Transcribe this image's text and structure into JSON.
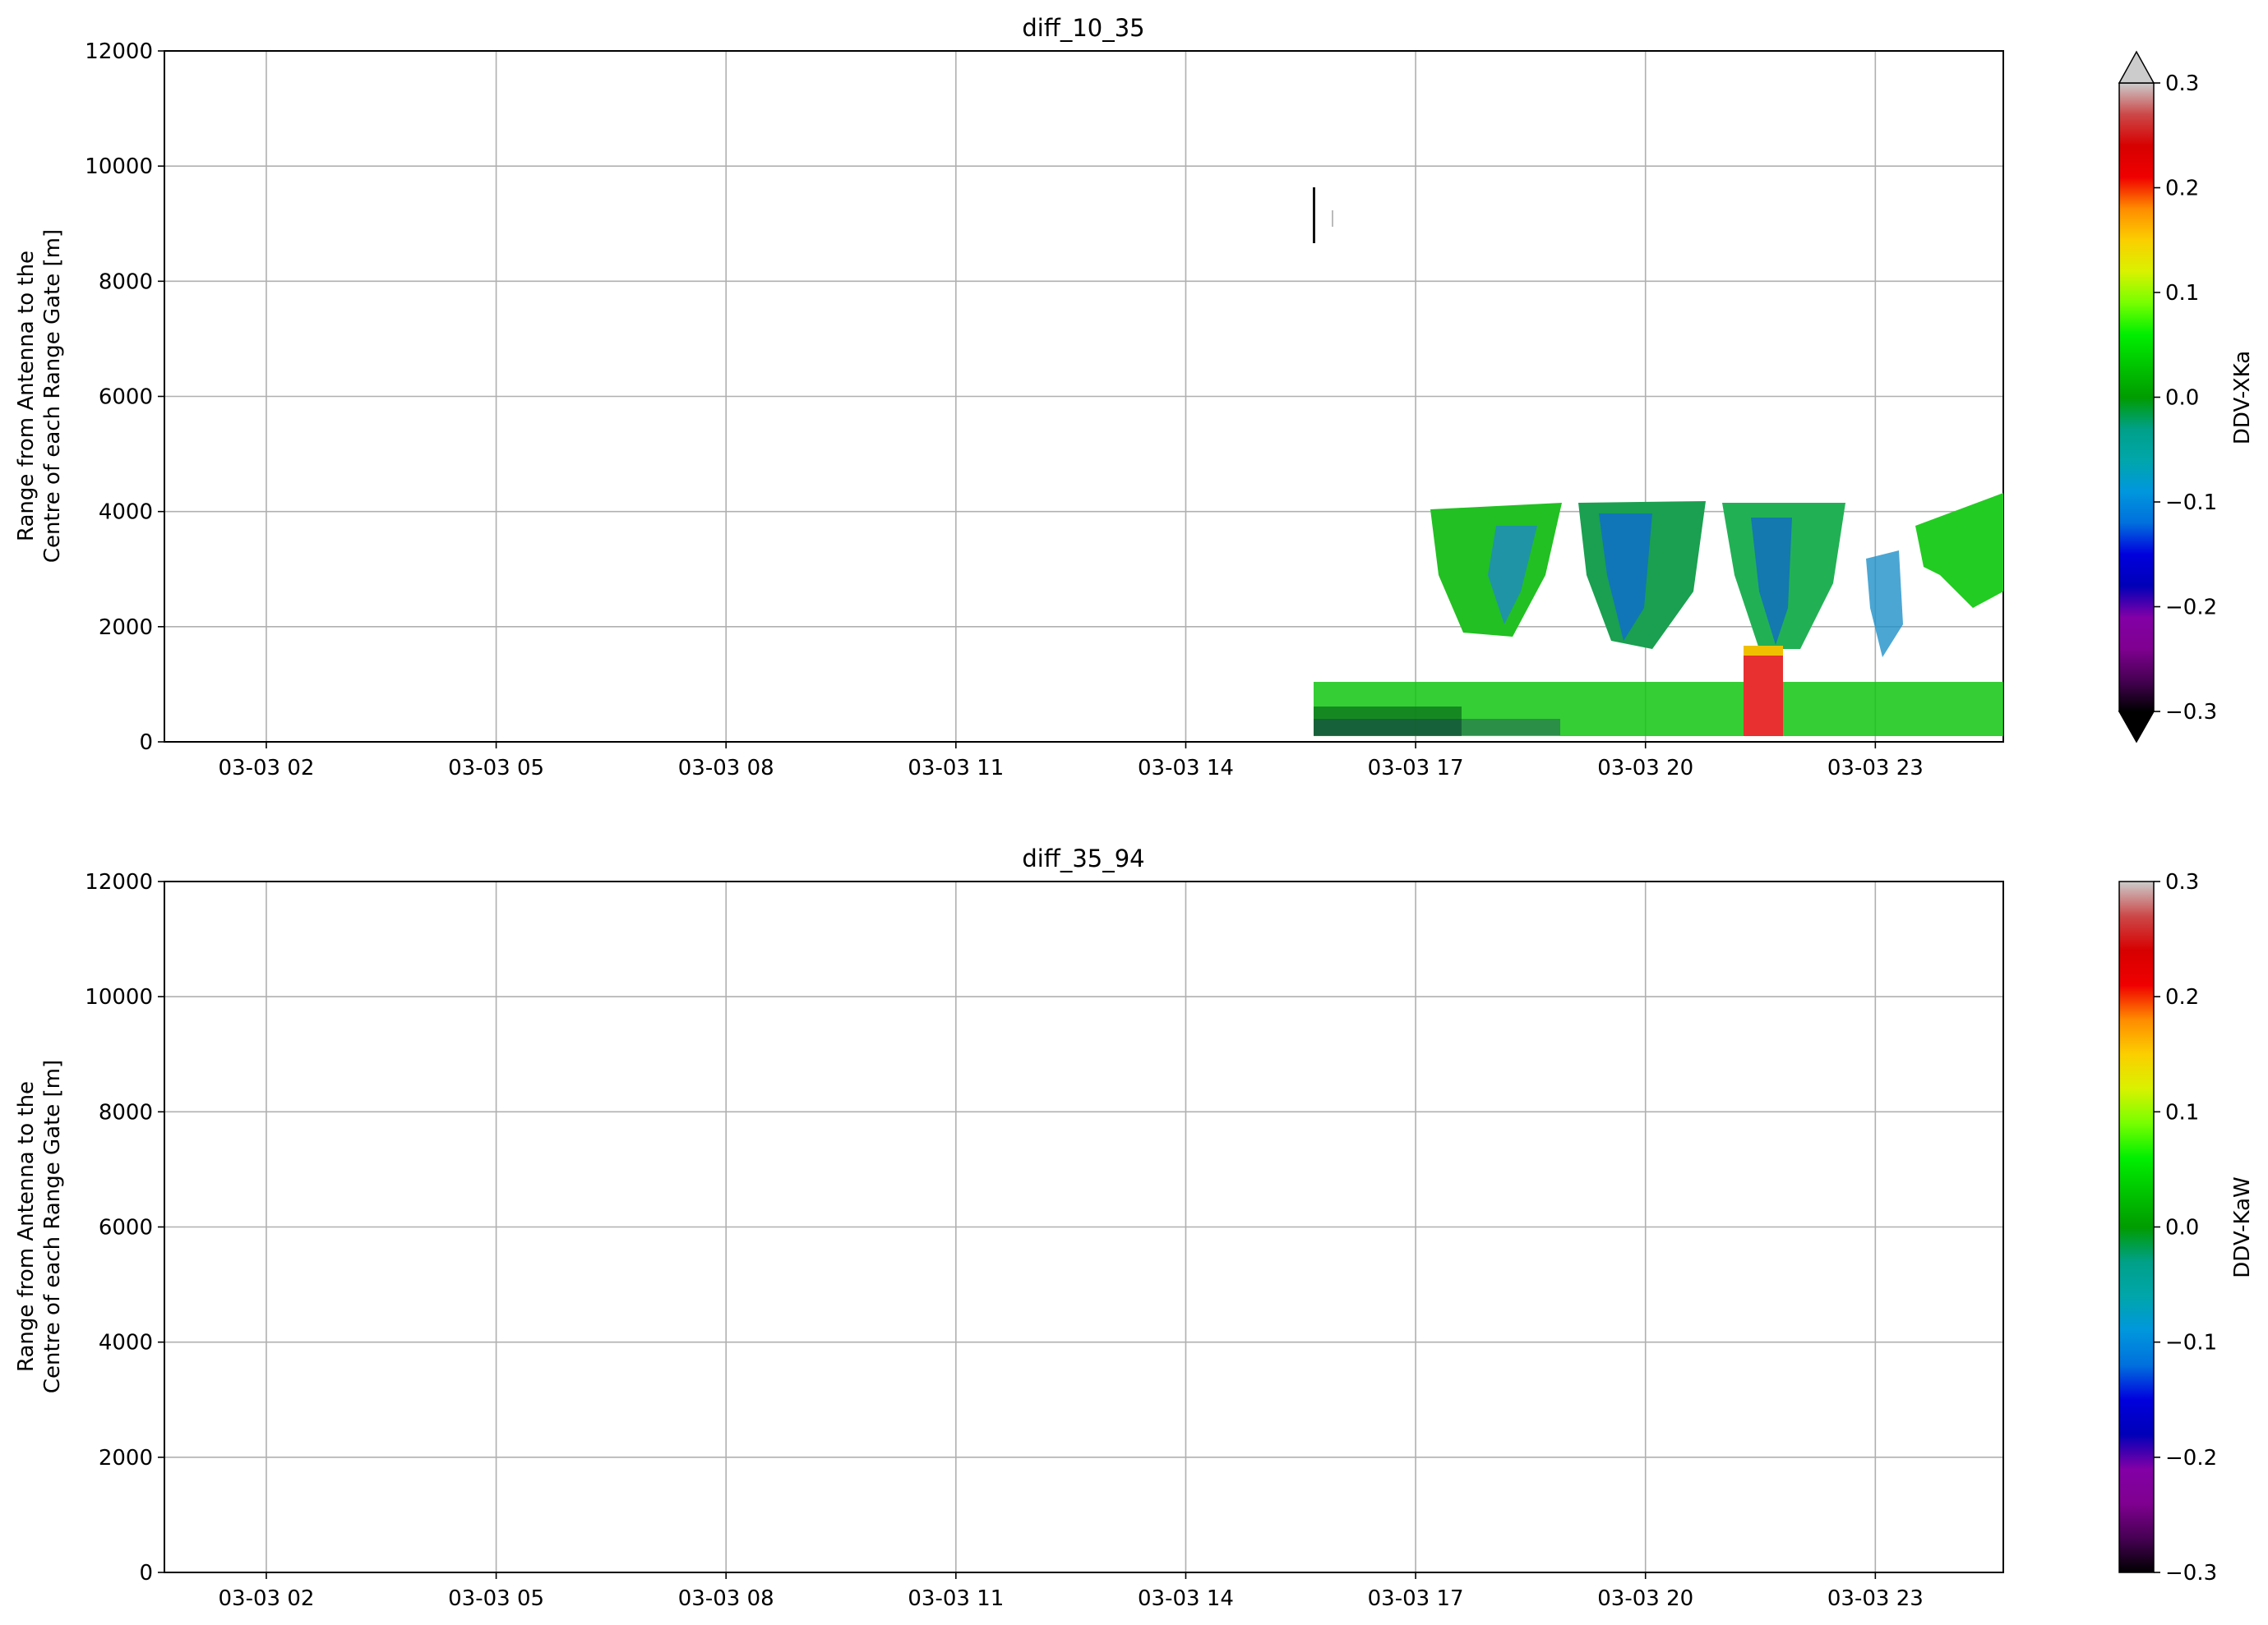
{
  "chart_data": [
    {
      "type": "heatmap",
      "title": "diff_10_35",
      "xlabel": "",
      "ylabel_lines": [
        "Range from Antenna to the",
        "Centre of each Range Gate [m]"
      ],
      "xlim_hours": [
        0.67,
        24.67
      ],
      "ylim": [
        0,
        12000
      ],
      "y_ticks": [
        0,
        2000,
        4000,
        6000,
        8000,
        10000,
        12000
      ],
      "x_ticks": [
        {
          "hour": 2,
          "label": "03-03 02"
        },
        {
          "hour": 5,
          "label": "03-03 05"
        },
        {
          "hour": 8,
          "label": "03-03 08"
        },
        {
          "hour": 11,
          "label": "03-03 11"
        },
        {
          "hour": 14,
          "label": "03-03 14"
        },
        {
          "hour": 17,
          "label": "03-03 17"
        },
        {
          "hour": 20,
          "label": "03-03 20"
        },
        {
          "hour": 23,
          "label": "03-03 23"
        }
      ],
      "grid": true,
      "colorbar": {
        "label": "DDV-XKa",
        "vmin": -0.3,
        "vmax": 0.3,
        "ticks": [
          -0.3,
          -0.2,
          -0.1,
          0.0,
          0.1,
          0.2,
          0.3
        ],
        "tick_labels": [
          "−0.3",
          "−0.2",
          "−0.1",
          "0.0",
          "0.1",
          "0.2",
          "0.3"
        ],
        "extend": "both",
        "colormap": "nipy_spectral",
        "over_color": "#cccccc",
        "under_color": "#000000"
      },
      "data_regions": [
        {
          "name": "low-level clutter",
          "x": [
            15.3,
            24.6
          ],
          "y": [
            0,
            1000
          ],
          "value": 0.03
        },
        {
          "name": "fallstreak 1",
          "x": [
            17.5,
            19.0
          ],
          "y": [
            1400,
            4200
          ],
          "value": -0.02
        },
        {
          "name": "fallstreak 2",
          "x": [
            18.6,
            20.0
          ],
          "y": [
            1500,
            4200
          ],
          "value": -0.08
        },
        {
          "name": "fallstreak 3",
          "x": [
            20.2,
            21.8
          ],
          "y": [
            1500,
            4200
          ],
          "value": -0.05
        },
        {
          "name": "rain column",
          "x": [
            21.0,
            21.5
          ],
          "y": [
            100,
            1600
          ],
          "value": 0.2
        },
        {
          "name": "upper cloud",
          "x": [
            23.0,
            24.6
          ],
          "y": [
            2800,
            4300
          ],
          "value": 0.03
        },
        {
          "name": "high cirrus trace",
          "x": [
            15.35,
            15.45
          ],
          "y": [
            8700,
            9600
          ],
          "value": -0.3
        }
      ]
    },
    {
      "type": "heatmap",
      "title": "diff_35_94",
      "xlabel": "",
      "ylabel_lines": [
        "Range from Antenna to the",
        "Centre of each Range Gate [m]"
      ],
      "xlim_hours": [
        0.67,
        24.67
      ],
      "ylim": [
        0,
        12000
      ],
      "y_ticks": [
        0,
        2000,
        4000,
        6000,
        8000,
        10000,
        12000
      ],
      "x_ticks": [
        {
          "hour": 2,
          "label": "03-03 02"
        },
        {
          "hour": 5,
          "label": "03-03 05"
        },
        {
          "hour": 8,
          "label": "03-03 08"
        },
        {
          "hour": 11,
          "label": "03-03 11"
        },
        {
          "hour": 14,
          "label": "03-03 14"
        },
        {
          "hour": 17,
          "label": "03-03 17"
        },
        {
          "hour": 20,
          "label": "03-03 20"
        },
        {
          "hour": 23,
          "label": "03-03 23"
        }
      ],
      "grid": true,
      "colorbar": {
        "label": "DDV-KaW",
        "vmin": -0.3,
        "vmax": 0.3,
        "ticks": [
          -0.3,
          -0.2,
          -0.1,
          0.0,
          0.1,
          0.2,
          0.3
        ],
        "tick_labels": [
          "−0.3",
          "−0.2",
          "−0.1",
          "0.0",
          "0.1",
          "0.2",
          "0.3"
        ],
        "extend": "neither",
        "colormap": "nipy_spectral"
      },
      "data_regions": []
    }
  ]
}
